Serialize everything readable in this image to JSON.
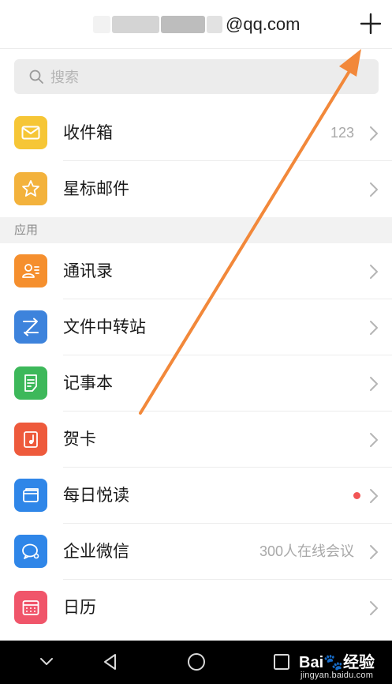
{
  "header": {
    "account_suffix": "@qq.com",
    "add_icon": "plus-icon"
  },
  "search": {
    "placeholder": "搜索",
    "icon": "search-icon"
  },
  "mail_items": [
    {
      "label": "收件箱",
      "value": "123",
      "icon": "inbox-icon",
      "color": "#f6c636"
    },
    {
      "label": "星标邮件",
      "value": "",
      "icon": "star-icon",
      "color": "#f3b23c"
    }
  ],
  "section": {
    "label": "应用"
  },
  "app_items": [
    {
      "label": "通讯录",
      "value": "",
      "icon": "contacts-icon",
      "color": "#f58f2e"
    },
    {
      "label": "文件中转站",
      "value": "",
      "icon": "transfer-icon",
      "color": "#3d83dc"
    },
    {
      "label": "记事本",
      "value": "",
      "icon": "notepad-icon",
      "color": "#3db85a"
    },
    {
      "label": "贺卡",
      "value": "",
      "icon": "greeting-card-icon",
      "color": "#ee5a3c"
    },
    {
      "label": "每日悦读",
      "value": "",
      "icon": "reading-icon",
      "color": "#2f86e8",
      "badge_color": "#f25555"
    },
    {
      "label": "企业微信",
      "value": "300人在线会议",
      "icon": "wework-icon",
      "color": "#2f86e8"
    },
    {
      "label": "日历",
      "value": "",
      "icon": "calendar-icon",
      "color": "#f0556a"
    }
  ],
  "navbar": {
    "buttons": [
      "chevron-down-icon",
      "back-icon",
      "home-icon",
      "recent-apps-icon"
    ]
  },
  "watermark": {
    "logo_text": "Bai",
    "logo_suffix": "经验",
    "url": "jingyan.baidu.com"
  },
  "annotation": {
    "arrow_color": "#f2883a"
  }
}
